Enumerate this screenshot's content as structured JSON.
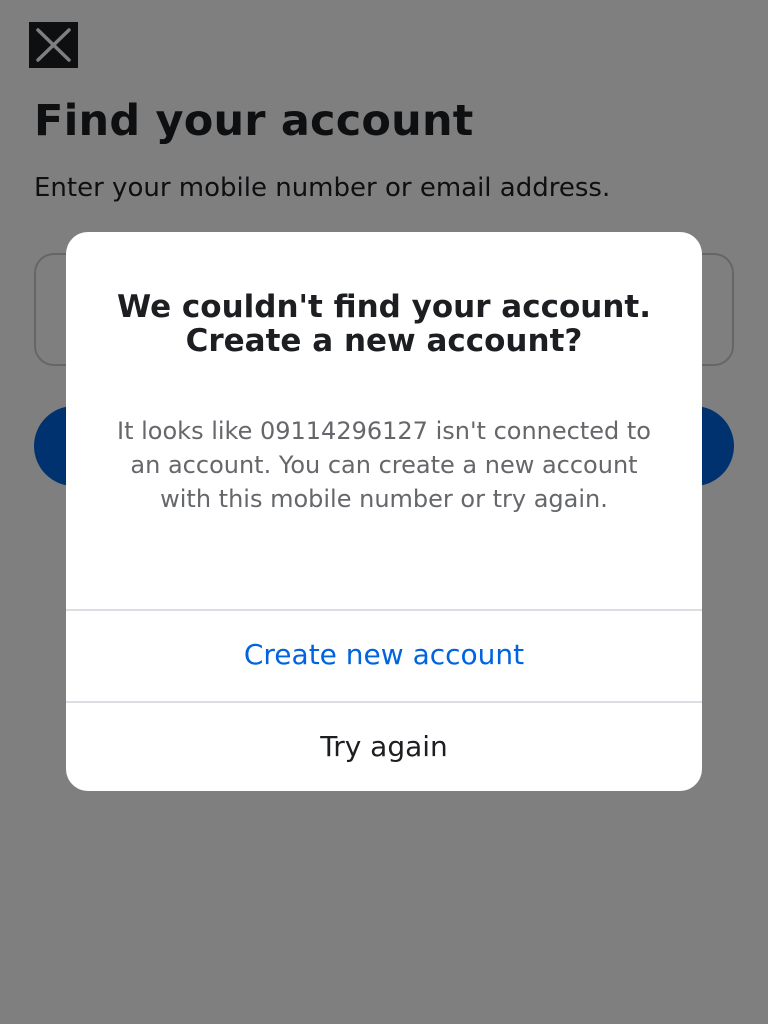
{
  "page": {
    "title": "Find your account",
    "subtitle": "Enter your mobile number or email address."
  },
  "dialog": {
    "title": "We couldn't find your account. Create a new account?",
    "message": "It looks like 09114296127 isn't connected to an account. You can create a new account with this mobile number or try again.",
    "primary_action": "Create new account",
    "secondary_action": "Try again"
  },
  "icons": {
    "close": "close-icon"
  },
  "colors": {
    "accent": "#0064e0",
    "text_primary": "#1c1e21",
    "text_secondary": "#65676b",
    "scrim": "rgba(0,0,0,0.5)"
  }
}
